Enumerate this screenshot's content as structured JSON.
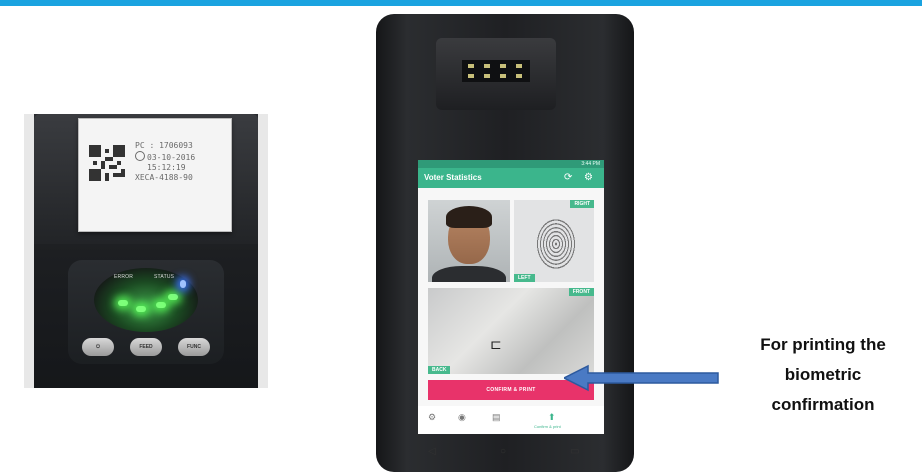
{
  "colors": {
    "top_bar": "#1aa3e0",
    "app_green": "#3bb58c",
    "confirm_pink": "#e8336a",
    "arrow_blue": "#4a7ac4"
  },
  "printer": {
    "receipt": {
      "line1": "PC : 1706093",
      "line2": "03-10-2016",
      "line3": "15:12:19",
      "line4": "XECA-4188-90"
    },
    "panel": {
      "error_label": "ERROR",
      "status_label": "STATUS",
      "power_icon": "power-icon",
      "feed_label": "FEED",
      "func_label": "FUNC"
    }
  },
  "phone": {
    "status_time": "3:44 PM",
    "app_title": "Voter Statistics",
    "refresh_icon": "refresh-icon",
    "settings_icon": "gear-icon",
    "tags": {
      "right": "RIGHT",
      "left": "LEFT",
      "front": "FRONT",
      "back": "BACK"
    },
    "confirm_button": "CONFIRM & PRINT",
    "nav_label": "Confirm & print"
  },
  "caption": {
    "line1": "For printing the",
    "line2": "biometric",
    "line3": "confirmation"
  }
}
